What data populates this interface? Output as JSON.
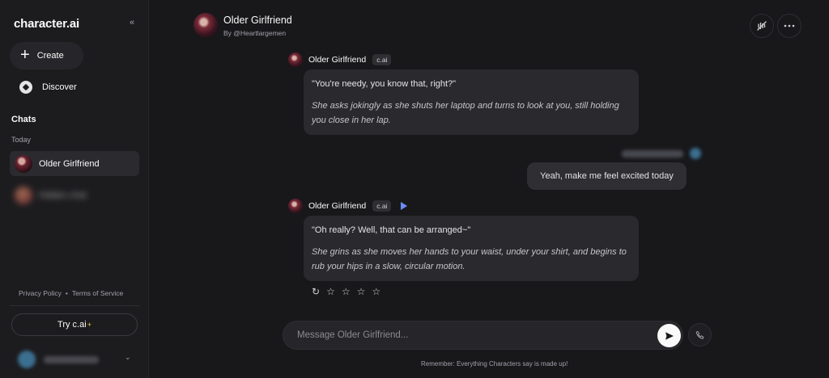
{
  "sidebar": {
    "logo": "character.ai",
    "collapse_icon": "«",
    "create_label": "Create",
    "discover_label": "Discover",
    "chats_heading": "Chats",
    "today_label": "Today",
    "chats": [
      {
        "name": "Older Girlfriend",
        "active": true
      },
      {
        "name": "Hidden chat",
        "blurred": true
      }
    ],
    "privacy_label": "Privacy Policy",
    "separator": "•",
    "terms_label": "Terms of Service",
    "try_label": "Try  c.ai",
    "try_badge": "+"
  },
  "header": {
    "title": "Older Girlfriend",
    "byline": "By @Heartlargemen",
    "mute_icon": "mute-voice-icon",
    "more_icon": "more-options-icon"
  },
  "messages": [
    {
      "author": "Older Girlfriend",
      "tag": "c.ai",
      "lines": [
        "\"You're needy, you know that, right?\"",
        "She asks jokingly as she shuts her laptop and turns to look at you, still holding you close in her lap."
      ]
    },
    {
      "author": "user",
      "text": "Yeah, make me feel excited today"
    },
    {
      "author": "Older Girlfriend",
      "tag": "c.ai",
      "lines": [
        "\"Oh really? Well, that can be arranged~\"",
        "She grins as she moves her hands to your waist, under your shirt, and begins to rub your hips in a slow, circular motion."
      ]
    }
  ],
  "rating": {
    "regenerate_icon": "↻",
    "star": "☆",
    "stars": 4
  },
  "composer": {
    "placeholder": "Message Older Girlfriend...",
    "send_icon": "send-icon",
    "call_icon": "phone-icon"
  },
  "disclaimer": "Remember: Everything Characters say is made up!",
  "colors": {
    "background": "#18181b",
    "sidebar": "#1c1c1f",
    "bubble": "#2a2a2e",
    "accent": "#6d8cf5"
  }
}
